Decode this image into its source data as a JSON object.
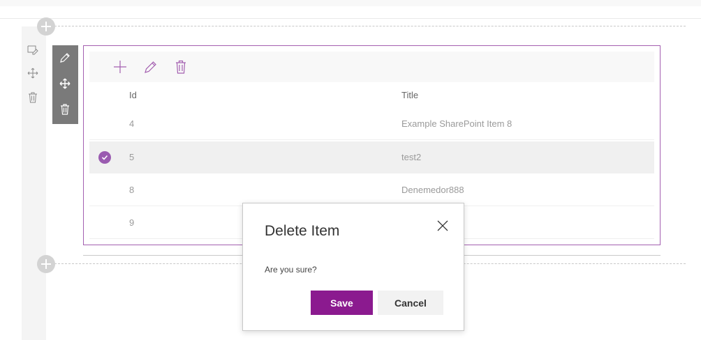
{
  "list": {
    "columns": {
      "id": "Id",
      "title": "Title"
    },
    "rows": [
      {
        "id": "4",
        "title": "Example SharePoint Item 8",
        "selected": false
      },
      {
        "id": "5",
        "title": "test2",
        "selected": true
      },
      {
        "id": "8",
        "title": "Denemedor888",
        "selected": false
      },
      {
        "id": "9",
        "title": "",
        "selected": false
      }
    ]
  },
  "dialog": {
    "title": "Delete Item",
    "message": "Are you sure?",
    "save_label": "Save",
    "cancel_label": "Cancel"
  },
  "icons": {
    "command_bar": [
      "add-icon",
      "edit-icon",
      "delete-icon"
    ],
    "webpart_toolbar": [
      "edit-icon",
      "move-icon",
      "delete-icon"
    ],
    "left_rail": [
      "edit-section-icon",
      "move-icon",
      "delete-icon"
    ],
    "section_add": "add-section-icon",
    "row_selected": "checkmark-icon",
    "dialog_close": "close-icon"
  },
  "colors": {
    "accent": "#8b1a8f",
    "webpart_border": "#a35fb0",
    "check_fill": "#9a5bb0",
    "toolbar_bg": "#7a7a7a"
  }
}
